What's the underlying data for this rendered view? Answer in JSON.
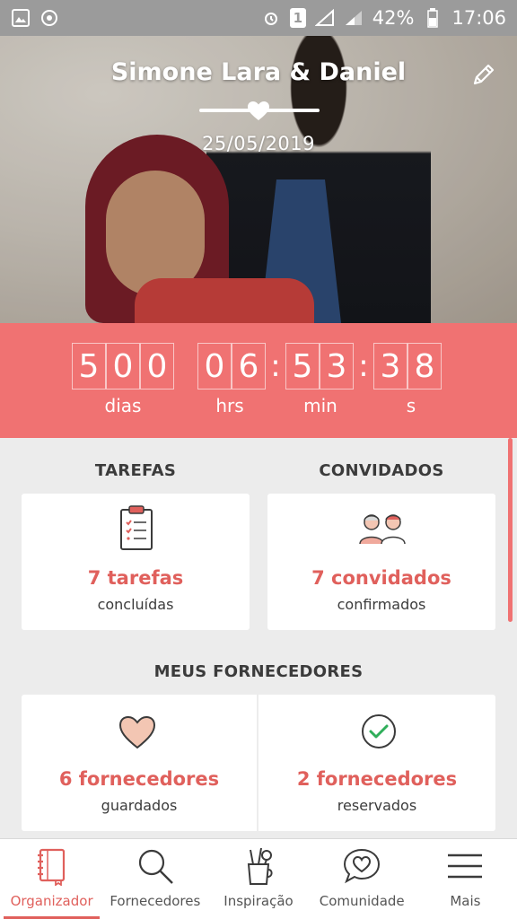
{
  "status_bar": {
    "battery": "42%",
    "time": "17:06",
    "sim": "1"
  },
  "hero": {
    "couple": "Simone Lara & Daniel",
    "date": "25/05/2019"
  },
  "countdown": {
    "days": [
      "5",
      "0",
      "0"
    ],
    "hours": [
      "0",
      "6"
    ],
    "minutes": [
      "5",
      "3"
    ],
    "seconds": [
      "3",
      "8"
    ],
    "labels": {
      "days": "dias",
      "hours": "hrs",
      "minutes": "min",
      "seconds": "s"
    }
  },
  "tasks": {
    "heading": "TAREFAS",
    "count": "7 tarefas",
    "status": "concluídas"
  },
  "guests": {
    "heading": "CONVIDADOS",
    "count": "7 convidados",
    "status": "confirmados"
  },
  "vendors": {
    "heading": "MEUS FORNECEDORES",
    "saved": {
      "count": "6 fornecedores",
      "status": "guardados"
    },
    "booked": {
      "count": "2 fornecedores",
      "status": "reservados"
    }
  },
  "bottom_nav": {
    "items": [
      {
        "label": "Organizador",
        "icon": "notebook-icon",
        "active": true
      },
      {
        "label": "Fornecedores",
        "icon": "search-icon",
        "active": false
      },
      {
        "label": "Inspiração",
        "icon": "pencil-cup-icon",
        "active": false
      },
      {
        "label": "Comunidade",
        "icon": "chat-heart-icon",
        "active": false
      },
      {
        "label": "Mais",
        "icon": "menu-icon",
        "active": false
      }
    ]
  },
  "colors": {
    "accent": "#f07272",
    "accent_text": "#e0605c",
    "status_bar": "#9b9b9b"
  }
}
